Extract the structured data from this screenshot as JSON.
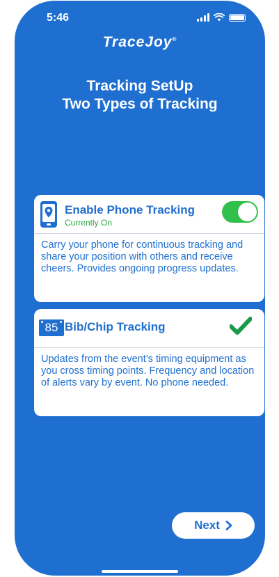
{
  "status_bar": {
    "time": "5:46"
  },
  "app": {
    "logo": "TraceJoy",
    "logo_mark": "®"
  },
  "heading": {
    "line1": "Tracking SetUp",
    "line2": "Two Types of Tracking"
  },
  "phone_tracking": {
    "title": "Enable Phone Tracking",
    "status": "Currently On",
    "toggle_on": true,
    "description": "Carry your phone for continuous tracking and share your position with others and receive cheers. Provides ongoing progress updates."
  },
  "bib_tracking": {
    "bib_number": "85",
    "title": "Bib/Chip Tracking",
    "selected": true,
    "description": "Updates from the event’s timing equipment as you cross timing points. Frequency and location of alerts vary by event. No phone needed."
  },
  "footer": {
    "next_label": "Next"
  },
  "colors": {
    "background": "#1f6fd0",
    "accent_green": "#31c04b",
    "status_green": "#2aa944",
    "check_green": "#1a9a49"
  }
}
